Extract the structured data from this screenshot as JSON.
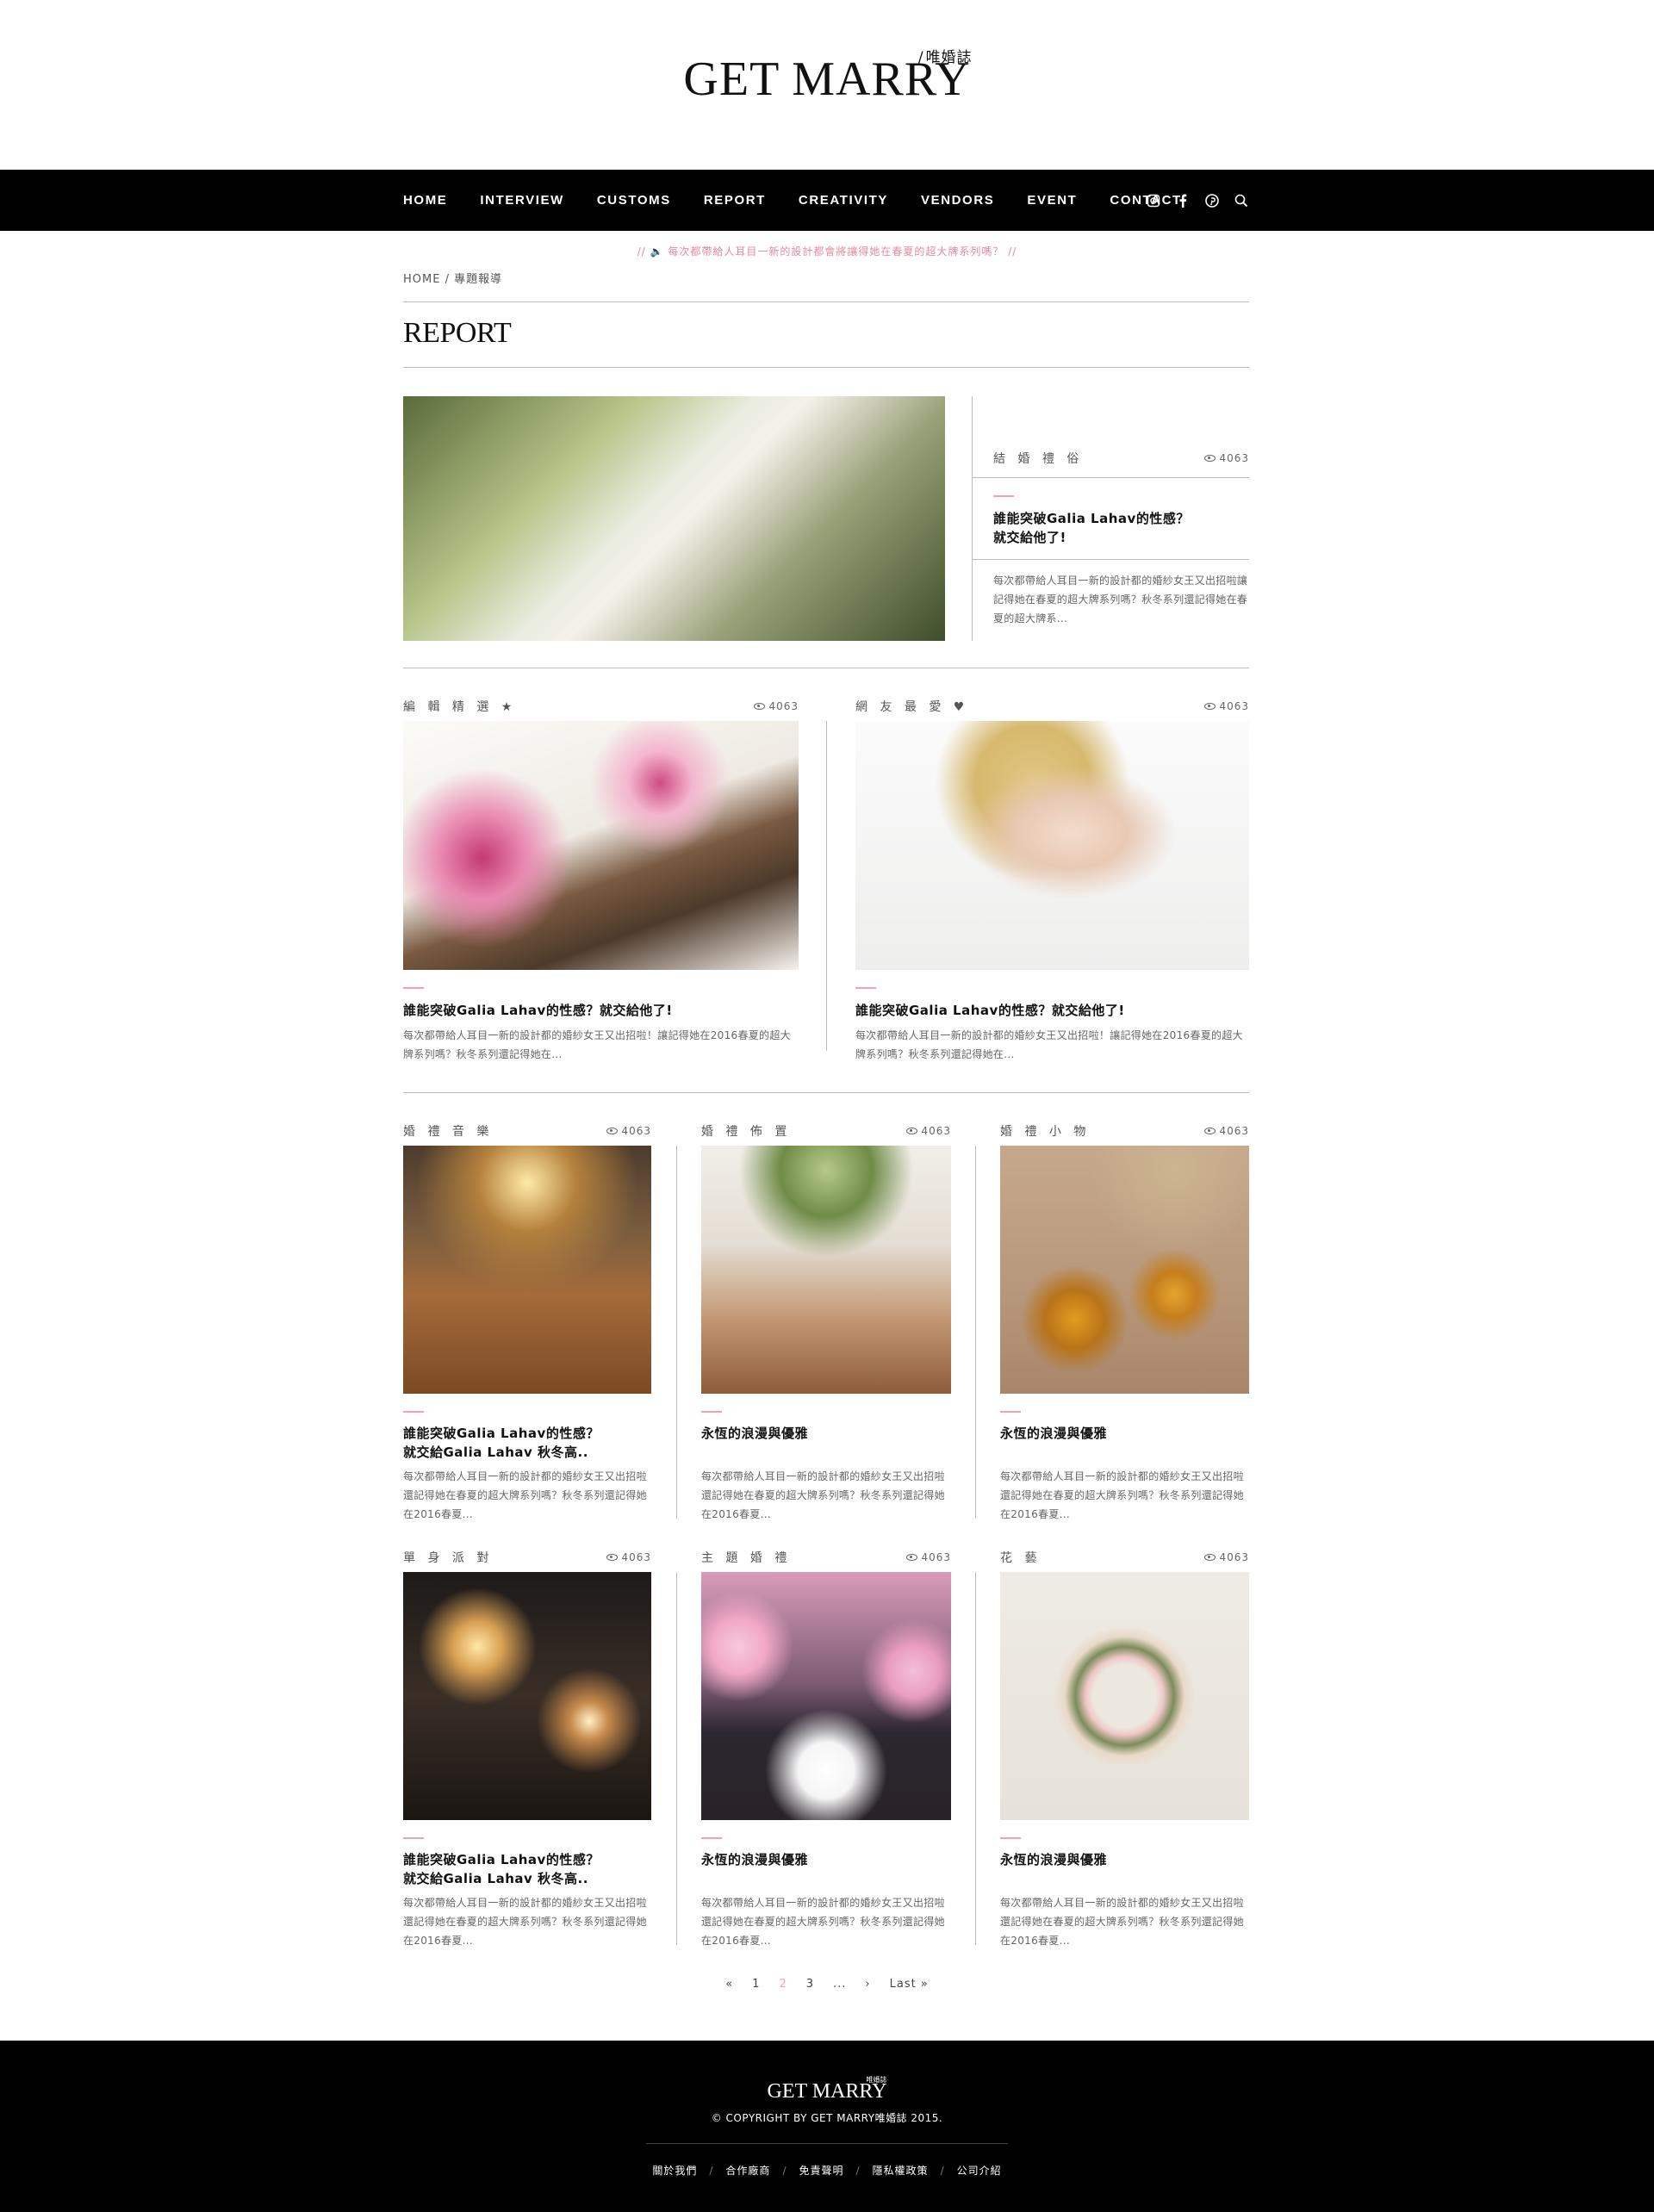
{
  "brand": {
    "logo": "GET MARRY",
    "logo_sub": "唯婚誌"
  },
  "nav": {
    "items": [
      "HOME",
      "INTERVIEW",
      "CUSTOMS",
      "REPORT",
      "CREATIVITY",
      "VENDORS",
      "EVENT",
      "CONTACT"
    ],
    "icons": [
      "instagram-icon",
      "facebook-icon",
      "pinterest-icon",
      "search-icon"
    ]
  },
  "announcement": "//  🔈  每次都帶給人耳目一新的設計都會將讓得她在春夏的超大牌系列嗎？  //",
  "breadcrumb": "HOME / 專題報導",
  "page_title": "REPORT",
  "featured": {
    "category": "結 婚 禮 俗",
    "views": "4063",
    "title_line1": "誰能突破Galia Lahav的性感？",
    "title_line2": "就交給他了!",
    "excerpt": "每次都帶給人耳目一新的設計都的婚紗女王又出招啦讓記得她在春夏的超大牌系列嗎？秋冬系列還記得她在春夏的超大牌系..."
  },
  "duo": [
    {
      "category": "編 輯 精 選 ★",
      "views": "4063",
      "title": "誰能突破Galia Lahav的性感？就交給他了!",
      "excerpt_line1": "每次都帶給人耳目一新的設計都的婚紗女王又出招啦！讓記得她在2016春夏的超大",
      "excerpt_line2": "牌系列嗎？秋冬系列還記得她在..."
    },
    {
      "category": "網 友 最 愛 ♥",
      "views": "4063",
      "title": "誰能突破Galia Lahav的性感？就交給他了!",
      "excerpt_line1": "每次都帶給人耳目一新的設計都的婚紗女王又出招啦！讓記得她在2016春夏的超大",
      "excerpt_line2": "牌系列嗎？秋冬系列還記得她在..."
    }
  ],
  "grid": [
    {
      "category": "婚 禮 音 樂",
      "views": "4063",
      "title_line1": "誰能突破Galia Lahav的性感？",
      "title_line2": "就交給Galia Lahav 秋冬高..",
      "excerpt_line1": "每次都帶給人耳目一新的設計都的婚紗女王又出招啦",
      "excerpt_line2": "還記得她在春夏的超大牌系列嗎？秋冬系列還記得她",
      "excerpt_line3": "在2016春夏..."
    },
    {
      "category": "婚 禮 佈 置",
      "views": "4063",
      "title_line1": "永恆的浪漫與優雅",
      "title_line2": "",
      "excerpt_line1": "每次都帶給人耳目一新的設計都的婚紗女王又出招啦",
      "excerpt_line2": "還記得她在春夏的超大牌系列嗎？秋冬系列還記得她",
      "excerpt_line3": "在2016春夏..."
    },
    {
      "category": "婚 禮 小 物",
      "views": "4063",
      "title_line1": "永恆的浪漫與優雅",
      "title_line2": "",
      "excerpt_line1": "每次都帶給人耳目一新的設計都的婚紗女王又出招啦",
      "excerpt_line2": "還記得她在春夏的超大牌系列嗎？秋冬系列還記得她",
      "excerpt_line3": "在2016春夏..."
    },
    {
      "category": "單 身 派 對",
      "views": "4063",
      "title_line1": "誰能突破Galia Lahav的性感？",
      "title_line2": "就交給Galia Lahav 秋冬高..",
      "excerpt_line1": "每次都帶給人耳目一新的設計都的婚紗女王又出招啦",
      "excerpt_line2": "還記得她在春夏的超大牌系列嗎？秋冬系列還記得她",
      "excerpt_line3": "在2016春夏..."
    },
    {
      "category": "主 題 婚 禮",
      "views": "4063",
      "title_line1": "永恆的浪漫與優雅",
      "title_line2": "",
      "excerpt_line1": "每次都帶給人耳目一新的設計都的婚紗女王又出招啦",
      "excerpt_line2": "還記得她在春夏的超大牌系列嗎？秋冬系列還記得她",
      "excerpt_line3": "在2016春夏..."
    },
    {
      "category": "花 藝",
      "views": "4063",
      "title_line1": "永恆的浪漫與優雅",
      "title_line2": "",
      "excerpt_line1": "每次都帶給人耳目一新的設計都的婚紗女王又出招啦",
      "excerpt_line2": "還記得她在春夏的超大牌系列嗎？秋冬系列還記得她",
      "excerpt_line3": "在2016春夏..."
    }
  ],
  "pagination": {
    "prev": "«",
    "pages": [
      "1",
      "2",
      "3"
    ],
    "current": "2",
    "ellipsis": "...",
    "next": "›",
    "last": "Last »"
  },
  "footer": {
    "logo": "GET MARRY",
    "logo_sub": "唯婚誌",
    "copyright": "© COPYRIGHT BY GET MARRY唯婚誌 2015.",
    "links": [
      "關於我們",
      "合作廠商",
      "免責聲明",
      "隱私權政策",
      "公司介紹"
    ]
  },
  "colors": {
    "accent_pink": "#f2a1ae",
    "nav_bg": "#000000",
    "footer_bg": "#000000"
  }
}
